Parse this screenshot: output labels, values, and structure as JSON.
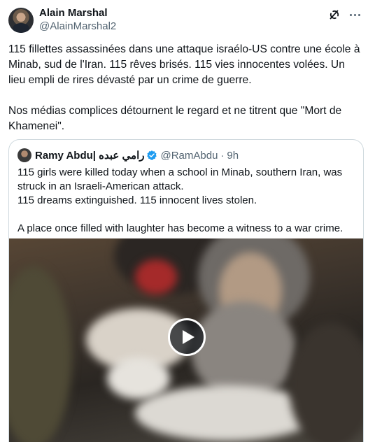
{
  "author": {
    "name": "Alain Marshal",
    "handle": "@AlainMarshal2"
  },
  "tweet_text": [
    "115 fillettes assassinées dans une attaque israélo-US contre une école à Minab, sud de l'Iran. 115 rêves brisés. 115 vies innocentes volées.  Un lieu empli de rires dévasté par un crime de guerre.",
    "Nos médias complices détournent le regard et ne titrent que \"Mort de Khamenei\"."
  ],
  "quoted": {
    "name": "Ramy Abdu| رامي عبده",
    "handle": "@RamAbdu",
    "separator": "·",
    "time": "9h",
    "text_lines": [
      "115 girls were killed today when a school in Minab, southern Iran, was struck in an Israeli-American attack.",
      "115 dreams extinguished. 115 innocent lives stolen.",
      "A place once filled with laughter has become a witness to a war crime."
    ]
  },
  "icons": {
    "grok": "grok-icon",
    "more": "more-icon",
    "verified": "verified-badge-icon",
    "play": "play-icon"
  },
  "colors": {
    "text": "#0f1419",
    "secondary": "#536471",
    "border": "#cfd9de",
    "verified": "#1d9bf0"
  }
}
